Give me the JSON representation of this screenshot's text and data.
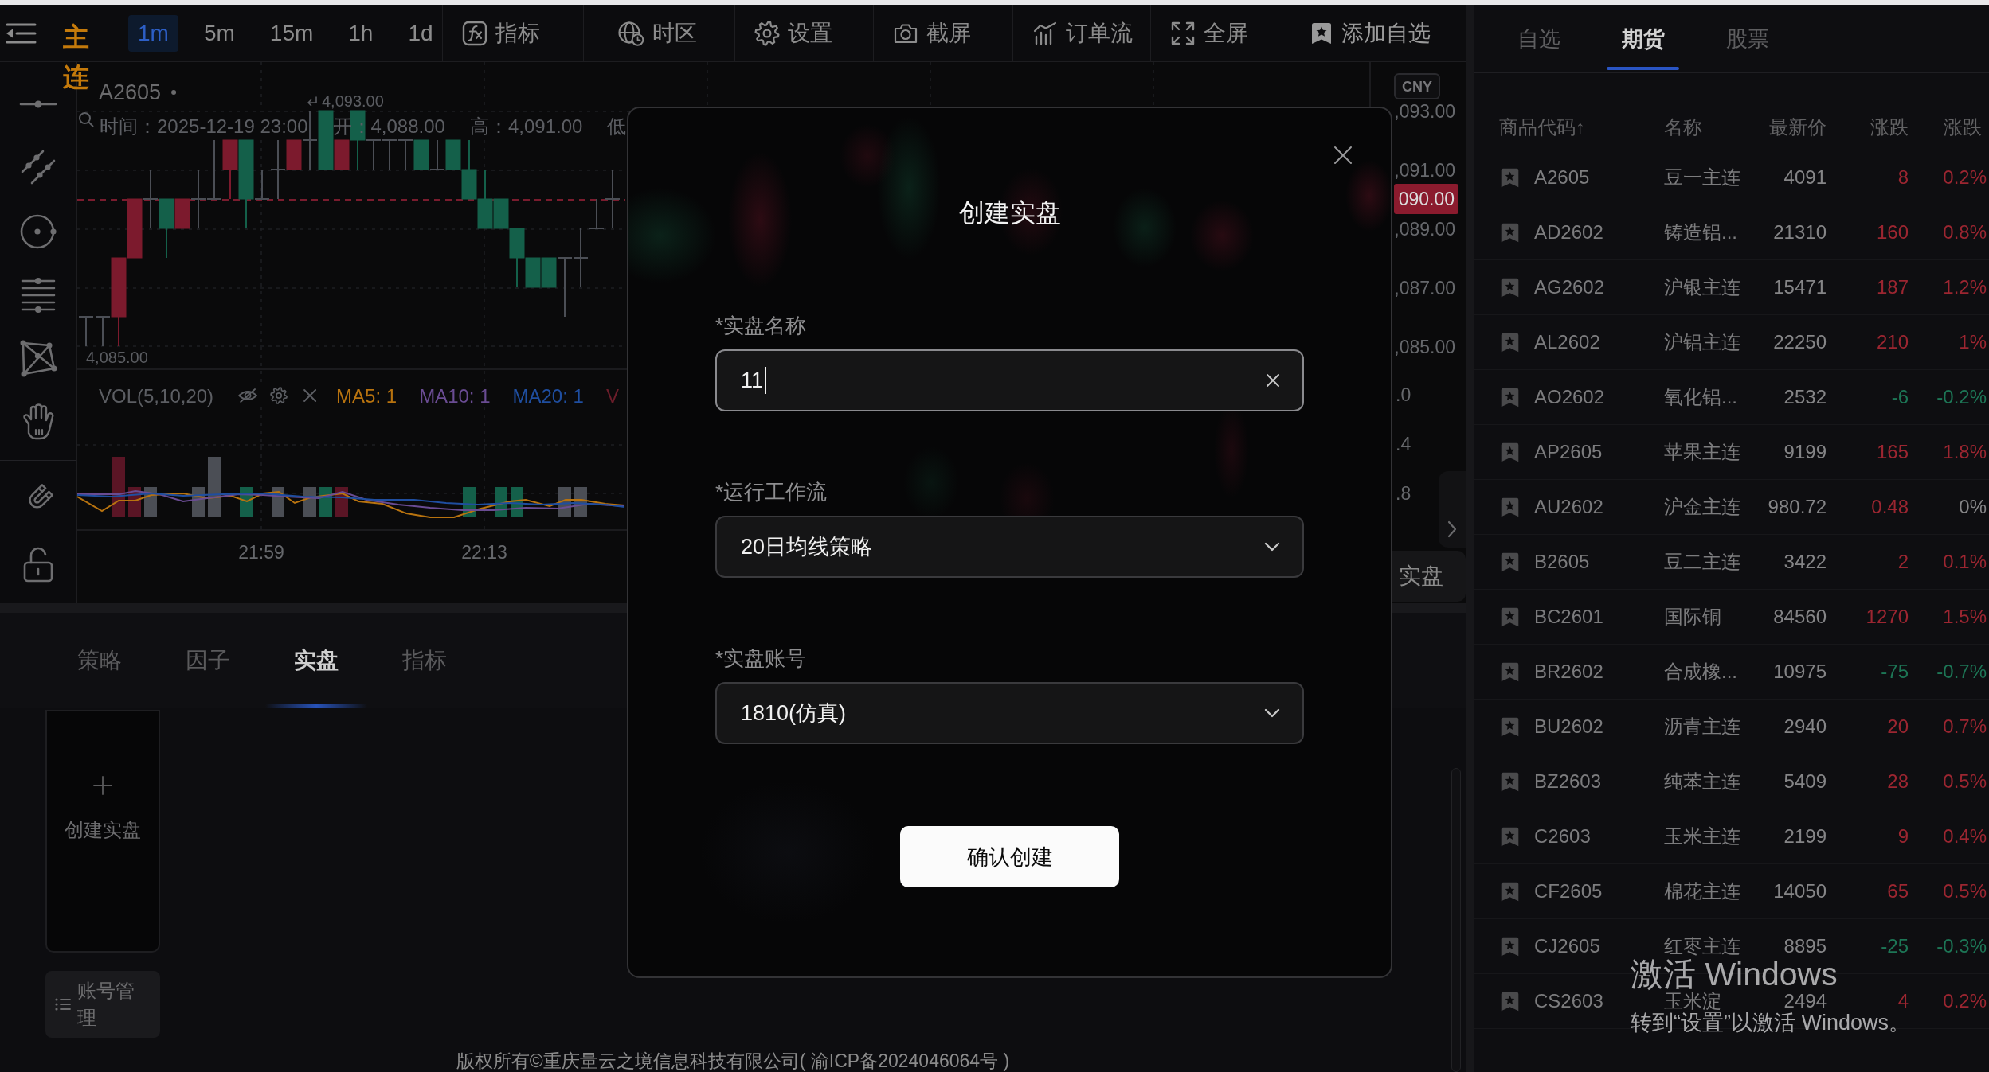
{
  "toolbar": {
    "contract_type": "主连",
    "timeframes": [
      {
        "label": "1m",
        "selected": true
      },
      {
        "label": "5m",
        "selected": false
      },
      {
        "label": "15m",
        "selected": false
      },
      {
        "label": "1h",
        "selected": false
      },
      {
        "label": "1d",
        "selected": false
      }
    ],
    "tools": [
      "指标",
      "时区",
      "设置",
      "截屏",
      "订单流",
      "全屏",
      "添加自选"
    ]
  },
  "chart": {
    "symbol": "A2605",
    "legend": [
      "时间：2025-12-19 23:00",
      "开：4,088.00",
      "高：4,091.00",
      "低"
    ],
    "high_marker": "4,093.00",
    "low_marker": "4,085.00",
    "currency": "CNY",
    "price_axis": [
      ",093.00",
      ",091.00",
      ",089.00",
      ",087.00",
      ",085.00"
    ],
    "last_price": "090.00",
    "volume_title": "VOL(5,10,20)",
    "averages": [
      {
        "label": "MA5: 1",
        "color": "#b8730f"
      },
      {
        "label": "MA10: 1",
        "color": "#6a4c93"
      },
      {
        "label": "MA20: 1",
        "color": "#1f4ea0"
      },
      {
        "label": "V",
        "color": "#6b1d2a"
      }
    ],
    "volume_axis": [
      ".0",
      ".4",
      ".8"
    ],
    "time_axis": [
      "21:59",
      "22:13"
    ],
    "side_button": "实盘"
  },
  "bottom_panel": {
    "tabs": [
      {
        "label": "策略",
        "selected": false
      },
      {
        "label": "因子",
        "selected": false
      },
      {
        "label": "实盘",
        "selected": true
      },
      {
        "label": "指标",
        "selected": false
      }
    ],
    "create_card": "创建实盘",
    "account_button": "账号管理"
  },
  "footer": "版权所有©重庆量云之境信息科技有限公司( 渝ICP备2024046064号 )",
  "market_panel": {
    "tabs": [
      {
        "label": "自选",
        "selected": false
      },
      {
        "label": "期货",
        "selected": true
      },
      {
        "label": "股票",
        "selected": false
      }
    ],
    "columns": [
      "商品代码↑",
      "名称",
      "最新价",
      "涨跌",
      "涨跌"
    ],
    "rows": [
      {
        "code": "A2605",
        "name": "豆一主连",
        "price": "4091",
        "change": {
          "text": "8",
          "color": "#9c2631"
        },
        "pct": {
          "text": "0.2%",
          "color": "#9c2631"
        }
      },
      {
        "code": "AD2602",
        "name": "铸造铝...",
        "price": "21310",
        "change": {
          "text": "160",
          "color": "#9c2631"
        },
        "pct": {
          "text": "0.8%",
          "color": "#9c2631"
        }
      },
      {
        "code": "AG2602",
        "name": "沪银主连",
        "price": "15471",
        "change": {
          "text": "187",
          "color": "#9c2631"
        },
        "pct": {
          "text": "1.2%",
          "color": "#9c2631"
        }
      },
      {
        "code": "AL2602",
        "name": "沪铝主连",
        "price": "22250",
        "change": {
          "text": "210",
          "color": "#9c2631"
        },
        "pct": {
          "text": "1%",
          "color": "#9c2631"
        }
      },
      {
        "code": "AO2602",
        "name": "氧化铝...",
        "price": "2532",
        "change": {
          "text": "-6",
          "color": "#1d7656"
        },
        "pct": {
          "text": "-0.2%",
          "color": "#1d7656"
        }
      },
      {
        "code": "AP2605",
        "name": "苹果主连",
        "price": "9199",
        "change": {
          "text": "165",
          "color": "#9c2631"
        },
        "pct": {
          "text": "1.8%",
          "color": "#9c2631"
        }
      },
      {
        "code": "AU2602",
        "name": "沪金主连",
        "price": "980.72",
        "change": {
          "text": "0.48",
          "color": "#9c2631"
        },
        "pct": {
          "text": "0%",
          "color": "#858587"
        }
      },
      {
        "code": "B2605",
        "name": "豆二主连",
        "price": "3422",
        "change": {
          "text": "2",
          "color": "#9c2631"
        },
        "pct": {
          "text": "0.1%",
          "color": "#9c2631"
        }
      },
      {
        "code": "BC2601",
        "name": "国际铜",
        "price": "84560",
        "change": {
          "text": "1270",
          "color": "#9c2631"
        },
        "pct": {
          "text": "1.5%",
          "color": "#9c2631"
        }
      },
      {
        "code": "BR2602",
        "name": "合成橡...",
        "price": "10975",
        "change": {
          "text": "-75",
          "color": "#1d7656"
        },
        "pct": {
          "text": "-0.7%",
          "color": "#1d7656"
        }
      },
      {
        "code": "BU2602",
        "name": "沥青主连",
        "price": "2940",
        "change": {
          "text": "20",
          "color": "#9c2631"
        },
        "pct": {
          "text": "0.7%",
          "color": "#9c2631"
        }
      },
      {
        "code": "BZ2603",
        "name": "纯苯主连",
        "price": "5409",
        "change": {
          "text": "28",
          "color": "#9c2631"
        },
        "pct": {
          "text": "0.5%",
          "color": "#9c2631"
        }
      },
      {
        "code": "C2603",
        "name": "玉米主连",
        "price": "2199",
        "change": {
          "text": "9",
          "color": "#9c2631"
        },
        "pct": {
          "text": "0.4%",
          "color": "#9c2631"
        }
      },
      {
        "code": "CF2605",
        "name": "棉花主连",
        "price": "14050",
        "change": {
          "text": "65",
          "color": "#9c2631"
        },
        "pct": {
          "text": "0.5%",
          "color": "#9c2631"
        }
      },
      {
        "code": "CJ2605",
        "name": "红枣主连",
        "price": "8895",
        "change": {
          "text": "-25",
          "color": "#1d7656"
        },
        "pct": {
          "text": "-0.3%",
          "color": "#1d7656"
        }
      },
      {
        "code": "CS2603",
        "name": "玉米淀",
        "price": "2494",
        "change": {
          "text": "4",
          "color": "#9c2631"
        },
        "pct": {
          "text": "0.2%",
          "color": "#9c2631"
        }
      }
    ]
  },
  "dialog": {
    "title": "创建实盘",
    "fields": [
      {
        "kind": "text",
        "label": "*实盘名称",
        "value": "11",
        "focused": true
      },
      {
        "kind": "select",
        "label": "*运行工作流",
        "value": "20日均线策略",
        "focused": false
      },
      {
        "kind": "select",
        "label": "*实盘账号",
        "value": "1810(仿真)",
        "focused": false
      }
    ],
    "submit": "确认创建"
  },
  "os_notice": {
    "title": "激活 Windows",
    "text": "转到“设置”以激活 Windows。"
  }
}
